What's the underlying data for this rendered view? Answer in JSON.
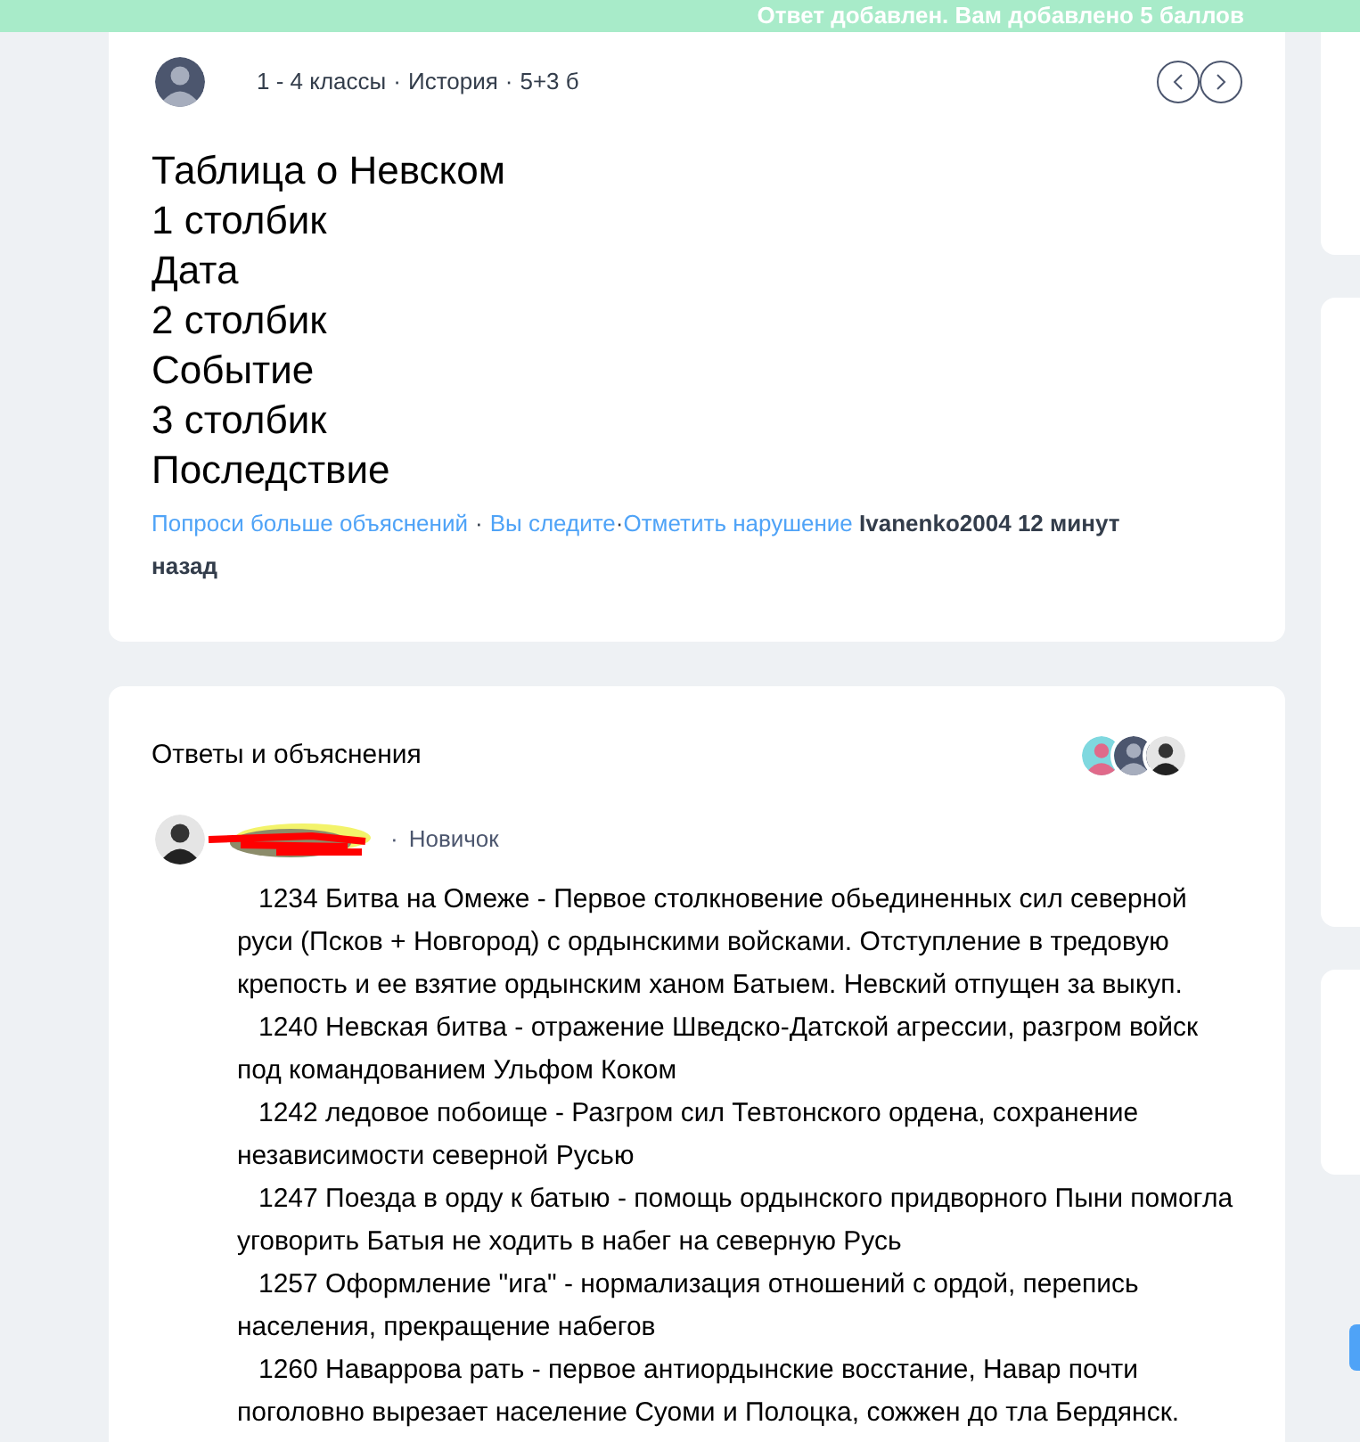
{
  "toast": {
    "text": "Ответ добавлен. Вам добавлено 5 баллов"
  },
  "separator": "·",
  "question": {
    "meta": [
      "1 - 4 классы",
      "История",
      "5+3 б"
    ],
    "lines": [
      "Таблица о Невском",
      "1 столбик",
      "Дата",
      "2 столбик",
      "Событие",
      "3 столбик",
      "Последствие"
    ],
    "links": [
      "Попроси больше объяснений",
      "Вы следите",
      "Отметить нарушение"
    ],
    "author": "Ivanenko2004",
    "time_lines": [
      "12 минут",
      "назад"
    ]
  },
  "answers": {
    "title": "Ответы и объяснения",
    "answer": {
      "rank": "Новичок",
      "paragraphs": [
        "1234 Битва на Омеже - Первое столкновение обьединенных сил северной руси (Псков + Новгород) с ордынскими войсками. Отступление в тредовую крепость и ее взятие ордынским ханом Батыем. Невский отпущен за выкуп.",
        "1240 Невская битва - отражение Шведско-Датской агрессии, разгром войск под командованием Ульфом Коком",
        "1242 ледовое побоище -  Разгром сил Тевтонского ордена, сохранение независимости северной Русью",
        "1247 Поезда в орду к батыю - помощь ордынского придворного Пыни помогла уговорить Батыя не ходить в набег на северную Русь",
        "1257 Оформление \"ига\" - нормализация отношений с ордой, перепись населения, прекращение набегов",
        "1260  Наваррова рать - первое антиордынские восстание, Навар почти поголовно вырезает население Суоми и Полоцка, сожжен до тла Бердянск."
      ]
    }
  }
}
